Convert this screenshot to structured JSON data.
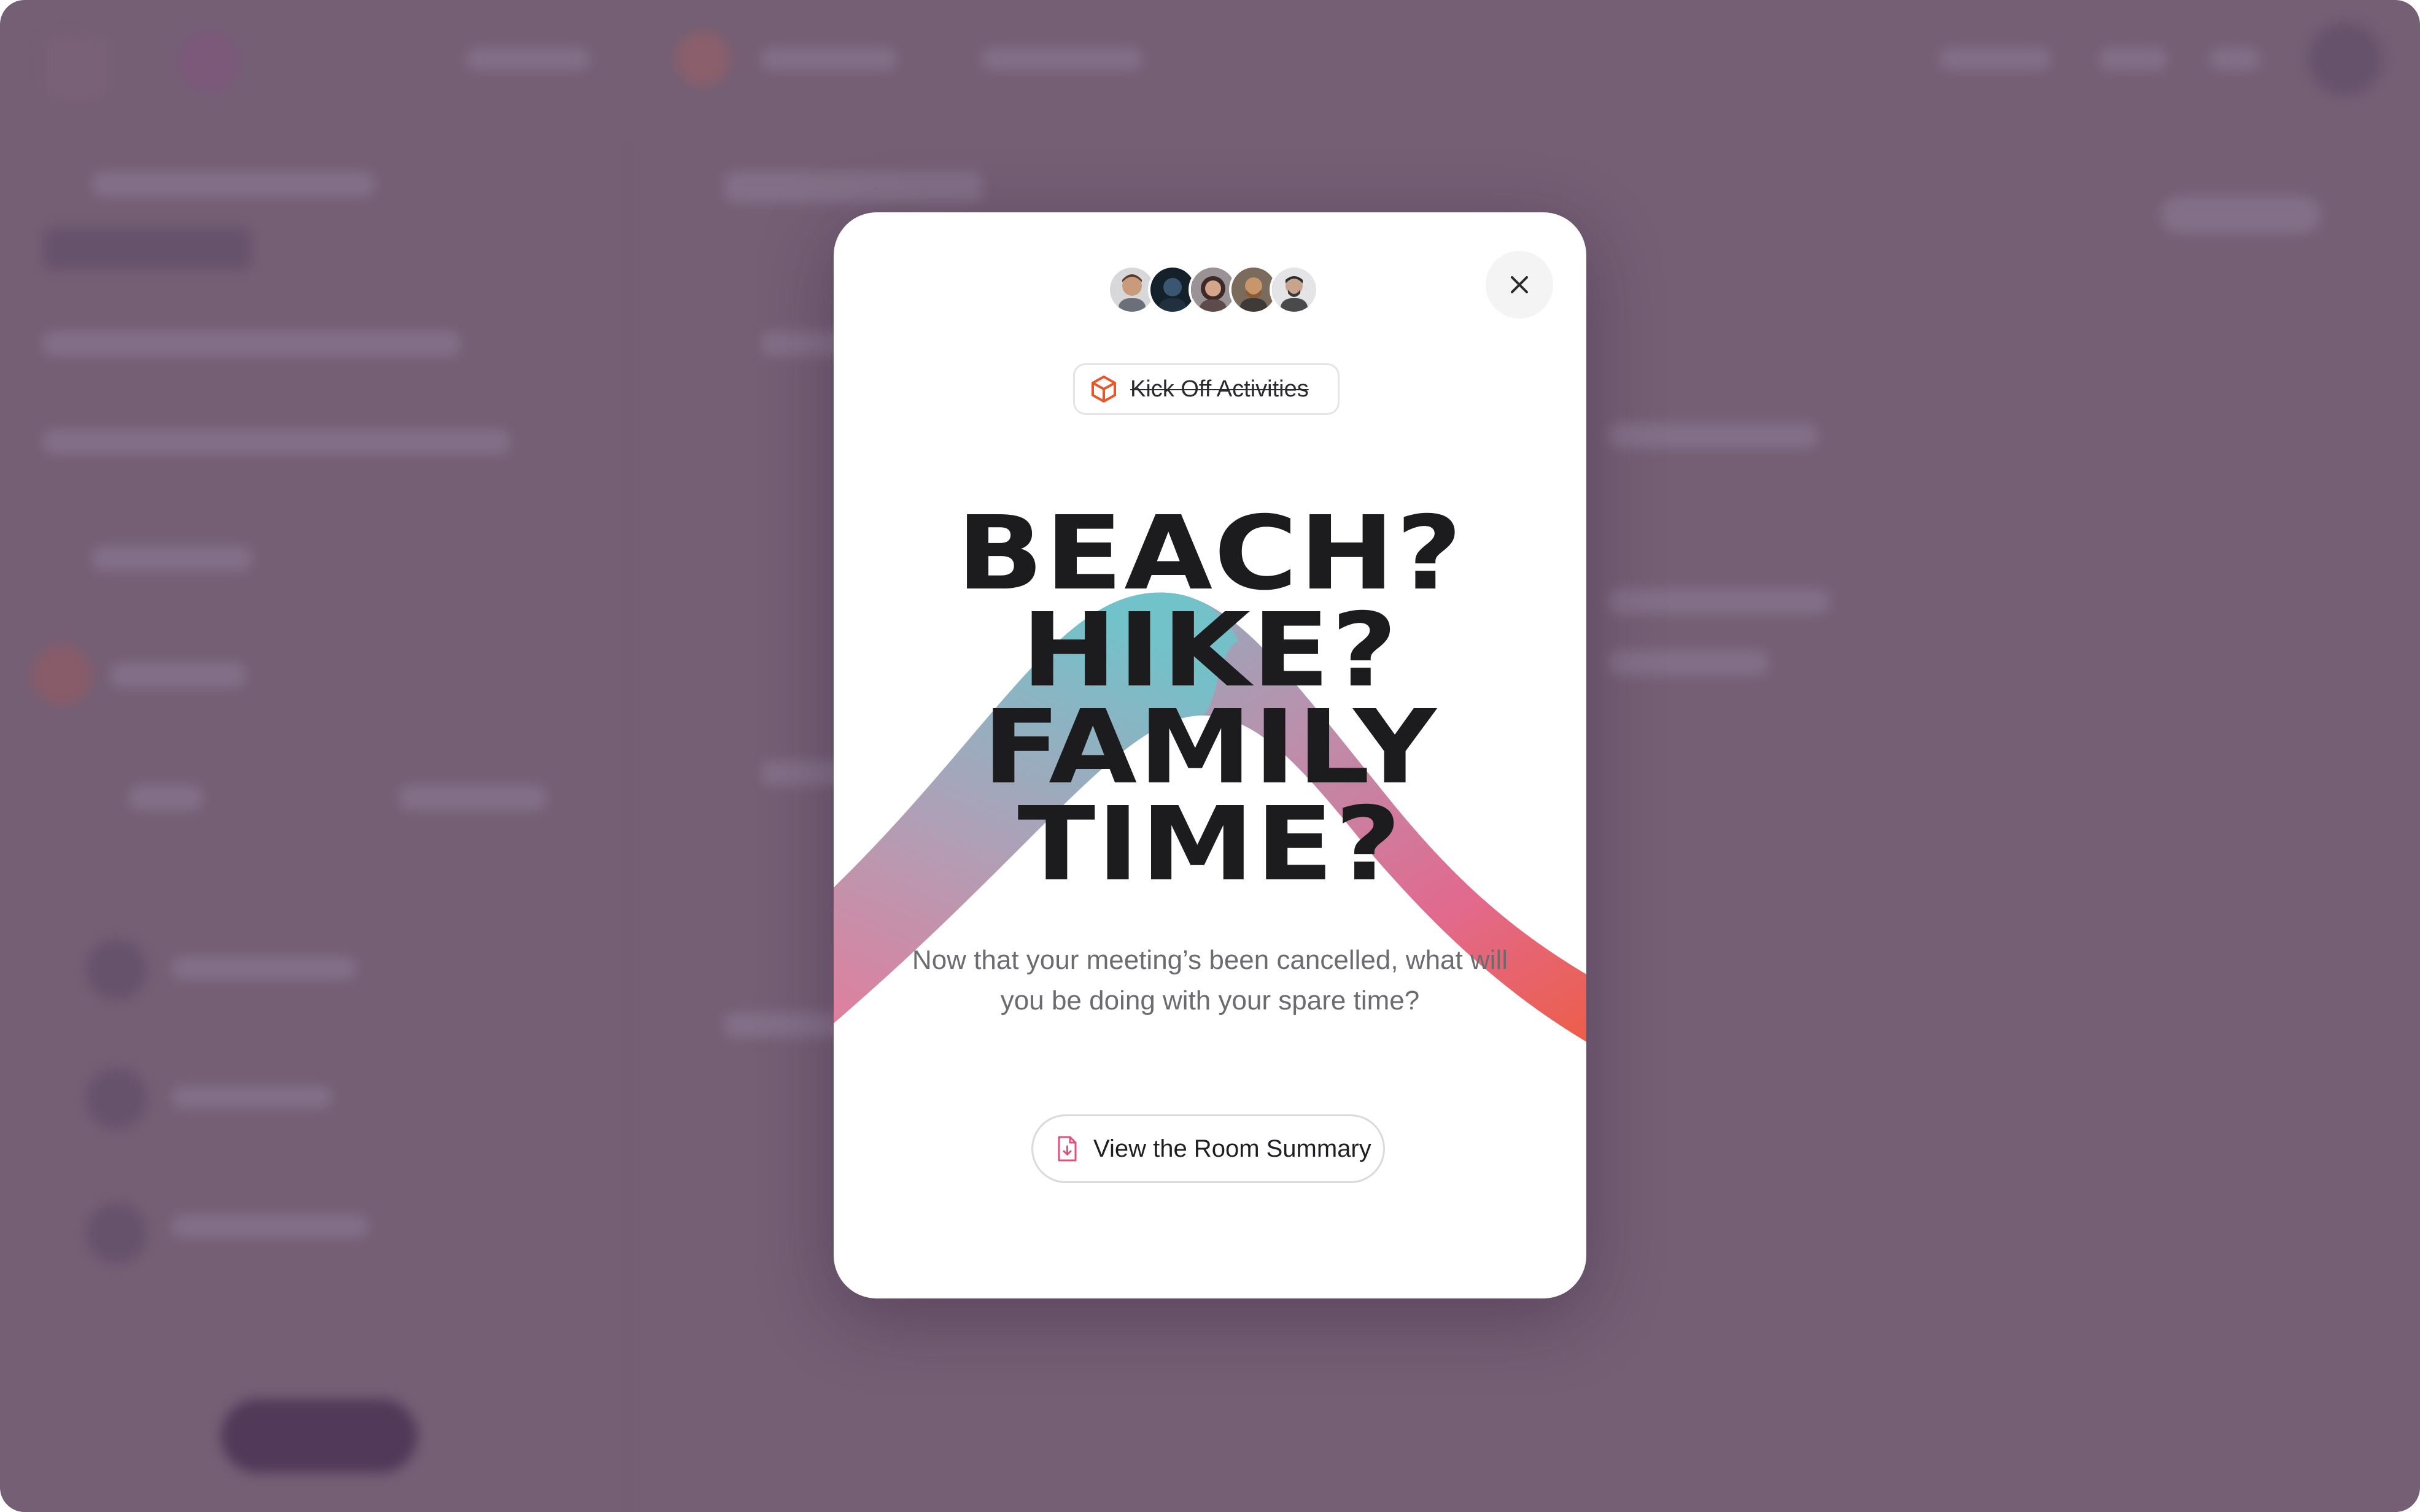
{
  "modal": {
    "tag_label": "Kick Off Activities",
    "headline": [
      "BEACH?",
      "HIKE?",
      "FAMILY",
      "TIME?"
    ],
    "subtext": "Now that your meeting’s been cancelled, what will you be doing with your spare time?",
    "summary_button_label": "View the Room Summary",
    "participants": [
      {
        "icon": "avatar-1"
      },
      {
        "icon": "avatar-2"
      },
      {
        "icon": "avatar-3"
      },
      {
        "icon": "avatar-4"
      },
      {
        "icon": "avatar-5"
      }
    ]
  },
  "colors": {
    "overlay": "#745f75",
    "tag_icon": "#e8572a",
    "wave_start": "#6cc6cc",
    "wave_mid": "#e16a8f",
    "wave_end": "#ee5d45",
    "headline": "#1c1c1e"
  }
}
